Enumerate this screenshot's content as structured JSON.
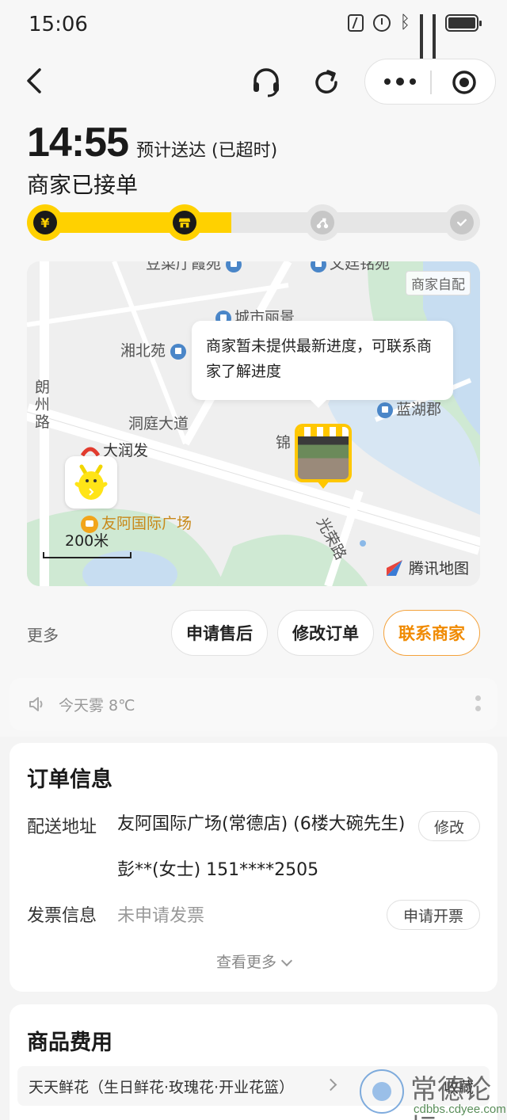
{
  "status_bar": {
    "time": "15:06",
    "icons": [
      "nfc-icon",
      "alarm-icon",
      "bluetooth-icon",
      "signal-icon",
      "signal-icon",
      "battery-icon"
    ]
  },
  "nav": {
    "icons": [
      "back-icon",
      "headset-icon",
      "refresh-icon",
      "more-icon",
      "target-icon"
    ]
  },
  "eta": {
    "time": "14:55",
    "label": "预计送达 (已超时)"
  },
  "order_status": "商家已接单",
  "progress": {
    "steps": [
      "payment",
      "merchant",
      "rider",
      "delivered"
    ],
    "step_icons": [
      "yen-icon",
      "shop-icon",
      "scooter-icon",
      "check-icon"
    ],
    "completed_steps": 2,
    "fill_fraction": 0.44,
    "step_glyphs": [
      "¥",
      "",
      "",
      ""
    ]
  },
  "map": {
    "self_pickup_tag": "商家自配",
    "tooltip": "商家暂未提供最新进度，可联系商家了解进度",
    "labels": {
      "top_left_poi": "豆菜厅霞苑",
      "top_right_poi": "文廷铭苑",
      "city_poi": "城市丽景",
      "xiangbei": "湘北苑",
      "lanhu": "蓝湖郡",
      "langzhou_road": "朗州路",
      "dongting_road": "洞庭大道",
      "jin": "锦",
      "darunfa": "大润发",
      "destination": "友阿国际广场",
      "guangrong_road": "光荣路",
      "scale": "200米",
      "provider": "腾讯地图"
    },
    "colors": {
      "water": "#c7ddf1",
      "green": "#cfe9d3",
      "road": "#ffffff"
    }
  },
  "actions": {
    "more_label": "更多",
    "after_sale": "申请售后",
    "modify_order": "修改订单",
    "contact_merchant": "联系商家",
    "accent_color": "#f08a00"
  },
  "weather": {
    "text": "今天雾 8℃"
  },
  "order_info": {
    "title": "订单信息",
    "address_label": "配送地址",
    "address": "友阿国际广场(常德店) (6楼大碗先生)",
    "contact": "彭**(女士) 151****2505",
    "modify_btn": "修改",
    "invoice_label": "发票信息",
    "invoice_value": "未申请发票",
    "invoice_btn": "申请开票",
    "see_more": "查看更多"
  },
  "goods": {
    "title": "商品费用",
    "shop_name": "天天鲜花（生日鲜花·玫瑰花·开业花篮）",
    "collect": "收藏"
  },
  "watermark": {
    "big": "常德论坛",
    "small": "cdbbs.cdyee.com"
  }
}
